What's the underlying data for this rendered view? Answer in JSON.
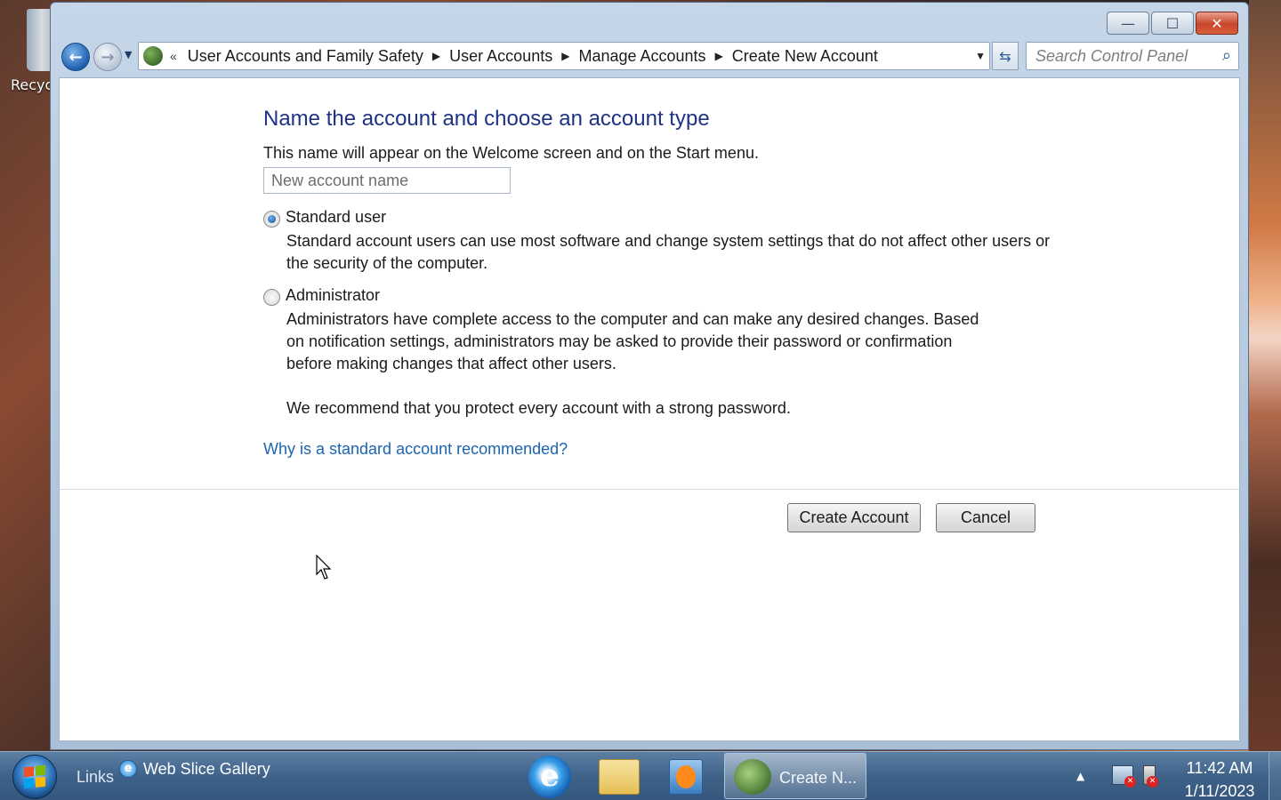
{
  "desktop": {
    "recycle_bin_label": "Recyc"
  },
  "window": {
    "controls": {
      "minimize": "—",
      "maximize": "☐",
      "close": "✕"
    }
  },
  "navigation": {
    "address_prefix": "«",
    "breadcrumbs": [
      "User Accounts and Family Safety",
      "User Accounts",
      "Manage Accounts",
      "Create New Account"
    ],
    "search_placeholder": "Search Control Panel"
  },
  "content": {
    "heading": "Name the account and choose an account type",
    "name_hint": "This name will appear on the Welcome screen and on the Start menu.",
    "name_placeholder": "New account name",
    "options": [
      {
        "label": "Standard user",
        "selected": true,
        "description": "Standard account users can use most software and change system settings that do not affect other users or the security of the computer."
      },
      {
        "label": "Administrator",
        "selected": false,
        "description": "Administrators have complete access to the computer and can make any desired changes. Based on notification settings, administrators may be asked to provide their password or confirmation before making changes that affect other users."
      }
    ],
    "recommendation": "We recommend that you protect every account with a strong password.",
    "help_link": "Why is a standard account recommended?",
    "buttons": {
      "create": "Create Account",
      "cancel": "Cancel"
    }
  },
  "taskbar": {
    "links_label": "Links",
    "web_slice_label": "Web Slice Gallery",
    "active_window_label": "Create N...",
    "clock_time": "11:42 AM",
    "clock_date": "1/11/2023"
  }
}
